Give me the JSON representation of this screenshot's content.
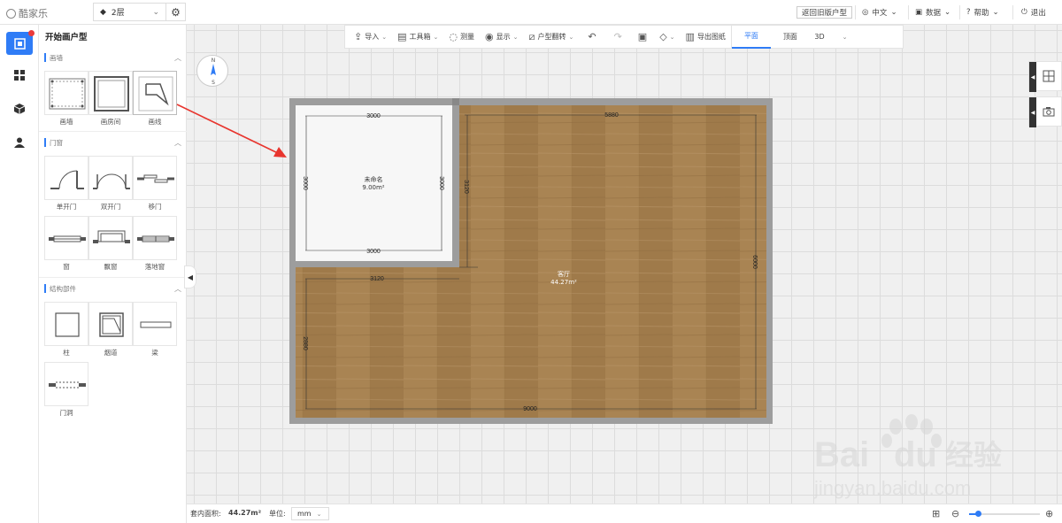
{
  "topbar": {
    "logo_text": "酷家乐",
    "floor_selected": "2层",
    "back_old": "返回旧版户型",
    "language": "中文",
    "data": "数据",
    "help": "帮助",
    "logout": "退出"
  },
  "rail": {
    "items": [
      "plan-icon",
      "layout-icon",
      "cube-icon",
      "user-icon"
    ]
  },
  "panel": {
    "title": "开始画户型",
    "sections": [
      {
        "title": "画墙",
        "items": [
          "画墙",
          "画房间",
          "画线"
        ]
      },
      {
        "title": "门窗",
        "items": [
          "单开门",
          "双开门",
          "移门",
          "窗",
          "飘窗",
          "落地窗"
        ]
      },
      {
        "title": "结构部件",
        "items": [
          "柱",
          "烟道",
          "梁",
          "门洞"
        ]
      }
    ]
  },
  "toolbar": {
    "items": [
      {
        "label": "导入",
        "icon": "import-icon",
        "dropdown": true
      },
      {
        "label": "工具箱",
        "icon": "toolbox-icon",
        "dropdown": true
      },
      {
        "label": "测量",
        "icon": "measure-icon",
        "dropdown": false
      },
      {
        "label": "显示",
        "icon": "eye-icon",
        "dropdown": true
      },
      {
        "label": "户型翻转",
        "icon": "flip-icon",
        "dropdown": true
      }
    ],
    "export_label": "导出图纸",
    "views": [
      "平面",
      "顶面",
      "3D"
    ],
    "active_view": "平面"
  },
  "compass": {
    "north": "N",
    "south": "S"
  },
  "plan": {
    "rooms": [
      {
        "name": "未命名",
        "area": "9.00m²"
      },
      {
        "name": "客厅",
        "area": "44.27m²"
      }
    ],
    "dimensions": {
      "room_top": "3000",
      "room_bottom": "3000",
      "room_left": "3000",
      "room_right": "3000",
      "hall_top": "5880",
      "partition_vertical": "3120",
      "partition_horizontal": "3120",
      "hall_right": "6000",
      "hall_left": "2880",
      "total_bottom": "9000"
    }
  },
  "statusbar": {
    "area_label": "套内面积:",
    "area_value": "44.27m²",
    "unit_label": "单位:",
    "unit_value": "mm",
    "zoom_level": 0.12
  },
  "watermark": {
    "brand": "Bai",
    "brand2": "du",
    "cn": "经验",
    "url": "jingyan.baidu.com"
  },
  "colors": {
    "accent": "#2f7cf6",
    "wall": "#9d9d9d",
    "floor_wood": "#a57f4f",
    "arrow": "#e8352e"
  }
}
